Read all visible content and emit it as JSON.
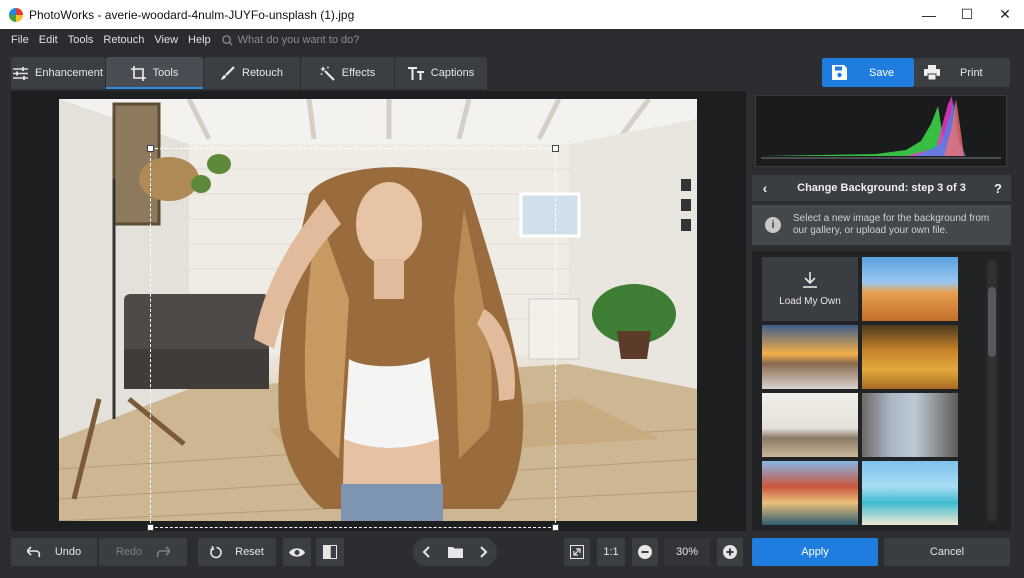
{
  "window": {
    "title": "PhotoWorks - averie-woodard-4nulm-JUYFo-unsplash (1).jpg",
    "minimize": "—",
    "maximize": "☐",
    "close": "✕"
  },
  "menu": {
    "items": [
      "File",
      "Edit",
      "Tools",
      "Retouch",
      "View",
      "Help"
    ],
    "search_placeholder": "What do you want to do?"
  },
  "tabs": [
    {
      "label": "Enhancement",
      "icon": "sliders-icon",
      "active": false
    },
    {
      "label": "Tools",
      "icon": "crop-icon",
      "active": true
    },
    {
      "label": "Retouch",
      "icon": "brush-icon",
      "active": false
    },
    {
      "label": "Effects",
      "icon": "magic-wand-icon",
      "active": false
    },
    {
      "label": "Captions",
      "icon": "text-icon",
      "active": false
    }
  ],
  "toolbar": {
    "save_label": "Save",
    "print_label": "Print"
  },
  "panel": {
    "step_title": "Change Background: step 3 of 3",
    "help": "?",
    "info_text": "Select a new image for the background from our gallery, or upload your own file.",
    "load_own_label": "Load My Own",
    "gallery": [
      "desert dunes",
      "sunset snowy road",
      "autumn forest",
      "living room interior",
      "city street",
      "coastal village",
      "tropical beach"
    ]
  },
  "bottom": {
    "undo_label": "Undo",
    "redo_label": "Redo",
    "reset_label": "Reset",
    "zoom_ratio": "1:1",
    "zoom_value": "30%",
    "apply_label": "Apply",
    "cancel_label": "Cancel"
  },
  "colors": {
    "accent": "#1f7de0",
    "background": "#2b2d30",
    "panel": "#3a3d41"
  }
}
